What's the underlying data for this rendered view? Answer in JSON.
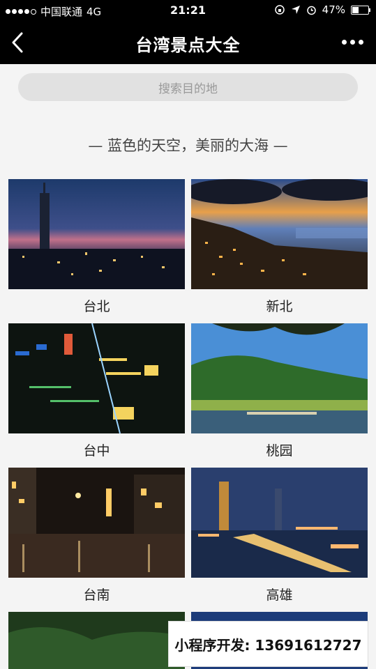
{
  "status_bar": {
    "carrier": "中国联通",
    "network": "4G",
    "time": "21:21",
    "battery": "47%",
    "battery_level": 0.47
  },
  "nav": {
    "title": "台湾景点大全"
  },
  "search": {
    "placeholder": "搜索目的地"
  },
  "tagline": "— 蓝色的天空，美丽的大海 —",
  "places": [
    {
      "name": "台北"
    },
    {
      "name": "新北"
    },
    {
      "name": "台中"
    },
    {
      "name": "桃园"
    },
    {
      "name": "台南"
    },
    {
      "name": "高雄"
    }
  ],
  "watermark": "小程序开发: 13691612727"
}
